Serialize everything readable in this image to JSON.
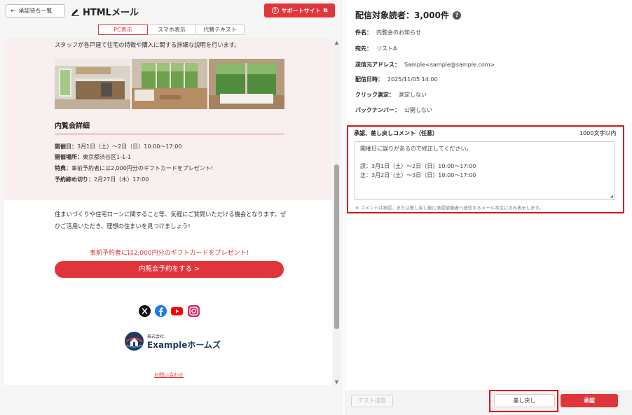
{
  "header": {
    "back_label": "承認待ち一覧",
    "title": "HTMLメール",
    "support_label": "サポートサイト",
    "brand_color": "#e0363b"
  },
  "view_tabs": [
    {
      "label": "PC表示",
      "active": true
    },
    {
      "label": "スマホ表示",
      "active": false
    },
    {
      "label": "代替テキスト",
      "active": false
    }
  ],
  "preview": {
    "intro": "スタッフが各戸建て住宅の特徴や購入に関する詳細な説明を行います。",
    "section_title": "内覧会詳細",
    "details": [
      {
        "label": "開催日：",
        "value": "3月1日（土）〜2日（日）10:00〜17:00"
      },
      {
        "label": "開催場所：",
        "value": "東京都渋谷区1-1-1"
      },
      {
        "label": "特典：",
        "value": "事前予約者には2,000円分のギフトカードをプレゼント!"
      },
      {
        "label": "予約締め切り：",
        "value": "2月27日（木）17:00"
      }
    ],
    "body_text": "住まいづくりや住宅ローンに関すること等、気軽にご質問いただける機会となります。ぜひご活用いただき、理想の住まいを見つけましょう!",
    "promo": "事前予約者には2,000円分のギフトカードをプレゼント!",
    "cta_label": "内覧会予約をする >",
    "social_icons": [
      "x-icon",
      "facebook-icon",
      "youtube-icon",
      "instagram-icon"
    ],
    "logo_sub": "株式会社",
    "logo_name": "Exampleホームズ",
    "contact_link": "お問い合わせ"
  },
  "info": {
    "heading": "配信対象読者：3,000件",
    "help_glyph": "?",
    "fields": [
      {
        "label": "件名：",
        "value": "内覧会のお知らせ"
      },
      {
        "label": "宛先：",
        "value": "リストA"
      },
      {
        "label": "送信元アドレス：",
        "value": "Sample<sample@sample.com>"
      },
      {
        "label": "配信日時：",
        "value": "2025/11/05 14:00"
      },
      {
        "label": "クリック測定：",
        "value": "測定しない"
      },
      {
        "label": "バックナンバー：",
        "value": "公開しない"
      }
    ]
  },
  "comment": {
    "label": "承認、差し戻しコメント（任意）",
    "limit": "1000文字以内",
    "lines": [
      "開催日に誤りがあるので修正してください。",
      "",
      "誤：3月1日（土）〜2日（日）10:00〜17:00",
      "正：3月2日（土）〜3日（日）10:00〜17:00"
    ],
    "note": "※ コメントは承認、または差し戻し後に承認依頼者へ送信するメール本文にのみ表示します。",
    "highlight_color": "#d9141c"
  },
  "footer": {
    "test_send": "テスト送信",
    "reject": "差し戻し",
    "approve": "承認"
  }
}
